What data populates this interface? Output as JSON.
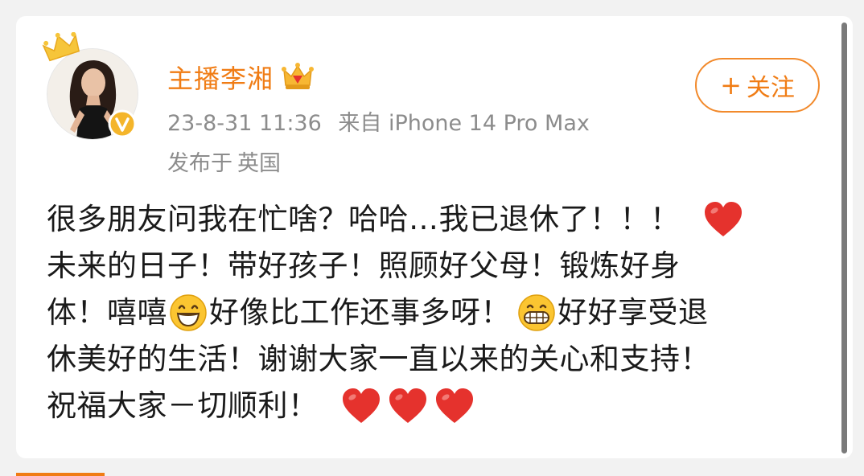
{
  "user": {
    "name": "主播李湘",
    "icons": {
      "avatar_crown": "gold-crown-icon",
      "vip_badge": "vip-crown-icon",
      "verified_badge": "verified-v-icon"
    }
  },
  "meta": {
    "timestamp": "23-8-31 11:36",
    "source": "来自 iPhone 14 Pro Max",
    "location_prefix": "发布于",
    "location": "英国"
  },
  "actions": {
    "follow_plus": "+",
    "follow_label": "关注"
  },
  "post": {
    "lines": [
      {
        "text": "很多朋友问我在忙啥？哈哈…我已退休了！！！"
      },
      {
        "text": "未来的日子！带好孩子！照顾好父母！锻炼好身"
      },
      {
        "seg1": "体！嘻嘻",
        "seg2": "好像比工作还事多呀！",
        "seg3": "好好享受退"
      },
      {
        "text": "休美好的生活！谢谢大家一直以来的关心和支持！"
      },
      {
        "text": "祝福大家－切顺利！"
      }
    ],
    "emoji": [
      "red-heart-icon",
      "grinning-face-icon",
      "grimacing-face-icon"
    ]
  },
  "colors": {
    "accent": "#f07c14",
    "meta_text": "#8c8c8c",
    "body_text": "#1a1a1a",
    "heart": "#e5322d",
    "card_bg": "#ffffff",
    "page_bg": "#f2f2f2"
  }
}
